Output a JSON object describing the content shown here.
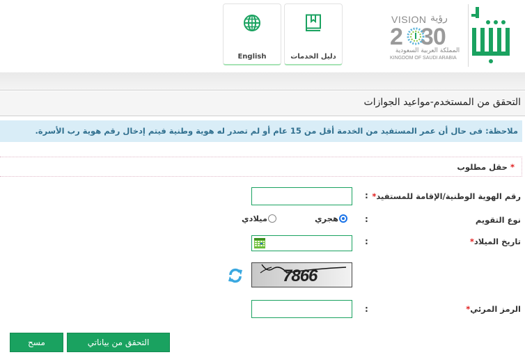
{
  "header": {
    "logo_absher_alt": "أبشر",
    "vision": {
      "word_en": "VISION",
      "word_ar": "رؤية",
      "year_left": "2",
      "year_right": "30",
      "kingdom_ar": "المملكة العربية السعودية",
      "kingdom_en": "KINGDOM OF SAUDI ARABIA"
    },
    "tiles": [
      {
        "label": "دليل الخدمات",
        "icon": "book-icon"
      },
      {
        "label": "English",
        "icon": "globe-icon"
      }
    ]
  },
  "page": {
    "title": "التحقق من المستخدم-مواعيد الجوازات",
    "note": "ملاحظة: فى حال أن عمر المستفيد من الخدمة أقل من 15 عام أو لم تصدر له هوية وطنية فيتم إدخال رقم هوية رب الأسرة.",
    "required_marker": "*",
    "required_text": "حقل مطلوب"
  },
  "form": {
    "id_number": {
      "label": "رقم الهوية الوطنية/الإقامة للمستفيد",
      "required": "*",
      "value": ""
    },
    "calendar_type": {
      "label": "نوع التقويم",
      "options": [
        {
          "label": "هجري",
          "selected": true
        },
        {
          "label": "ميلادي",
          "selected": false
        }
      ]
    },
    "birth_date": {
      "label": "تاريخ الميلاد",
      "required": "*",
      "value": ""
    },
    "captcha": {
      "image_text": "7866"
    },
    "visual_code": {
      "label": "الرمز المرئي",
      "required": "*",
      "value": ""
    },
    "colon": ":"
  },
  "buttons": {
    "verify": "التحقق من بياناتي",
    "clear": "مسح"
  },
  "colors": {
    "brand_green": "#1aa260",
    "note_bg": "#d9edf7",
    "note_text": "#31708f",
    "required_star": "#e02020"
  }
}
